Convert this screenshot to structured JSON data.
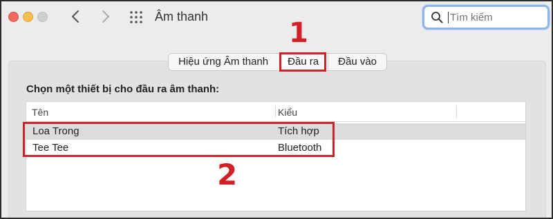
{
  "window": {
    "title": "Âm thanh",
    "traffic_lights": [
      "close",
      "minimize",
      "zoom-disabled"
    ],
    "icons": [
      "chevron-left-icon",
      "chevron-right-icon",
      "grid-icon"
    ]
  },
  "search": {
    "placeholder": "Tìm kiếm",
    "icon": "search-icon"
  },
  "tabs": [
    {
      "label": "Hiệu ứng Âm thanh",
      "active": false
    },
    {
      "label": "Đầu ra",
      "active": true
    },
    {
      "label": "Đầu vào",
      "active": false
    }
  ],
  "panel": {
    "label": "Chọn một thiết bị cho đầu ra âm thanh:"
  },
  "table": {
    "columns": [
      "Tên",
      "Kiểu"
    ],
    "rows": [
      {
        "name": "Loa Trong",
        "type": "Tích hợp",
        "selected": true
      },
      {
        "name": "Tee Tee",
        "type": "Bluetooth",
        "selected": false
      }
    ]
  },
  "annotations": {
    "step1": "1",
    "step2": "2",
    "color": "#d32026"
  },
  "colors": {
    "accent": "#d32026",
    "search_focus": "#8fb5e8",
    "selection": "#dcdcdc"
  }
}
